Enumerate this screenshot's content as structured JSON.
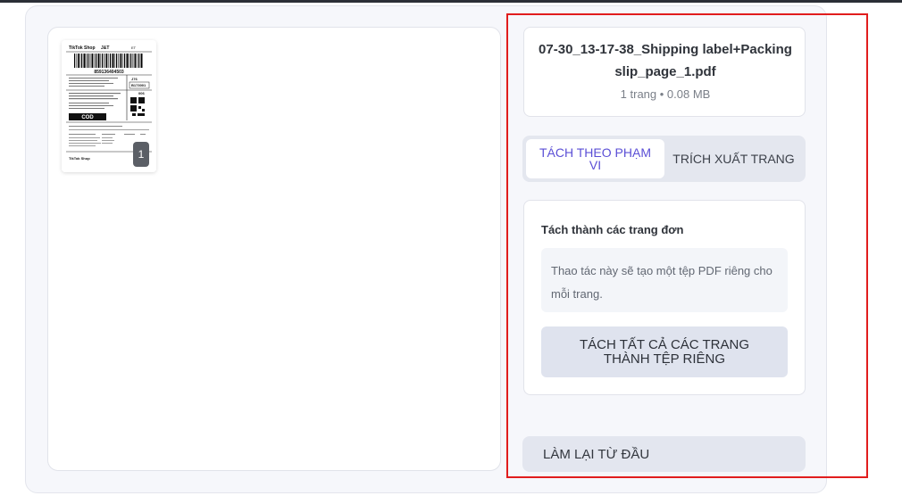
{
  "file": {
    "name": "07-30_13-17-38_Shipping label+Packing slip_page_1.pdf",
    "meta": "1 trang • 0.08 MB"
  },
  "preview": {
    "page_number": "1",
    "thumbnail_text": {
      "brand": "TikTok Shop",
      "carrier": "J&T",
      "barcode_number": "859136404503",
      "cod_label": "COD"
    }
  },
  "tabs": [
    {
      "label": "TÁCH THEO PHẠM VI",
      "active": true
    },
    {
      "label": "TRÍCH XUẤT TRANG",
      "active": false
    }
  ],
  "split_option": {
    "title": "Tách thành các trang đơn",
    "description": "Thao tác này sẽ tạo một tệp PDF riêng cho mỗi trang.",
    "button_label": "TÁCH TẤT CẢ CÁC TRANG THÀNH TỆP RIÊNG"
  },
  "reset_label": "LÀM LẠI TỪ ĐẦU",
  "colors": {
    "accent": "#5b4fd6",
    "highlight_border": "#e11d1d",
    "panel_background": "#f6f7fb"
  }
}
